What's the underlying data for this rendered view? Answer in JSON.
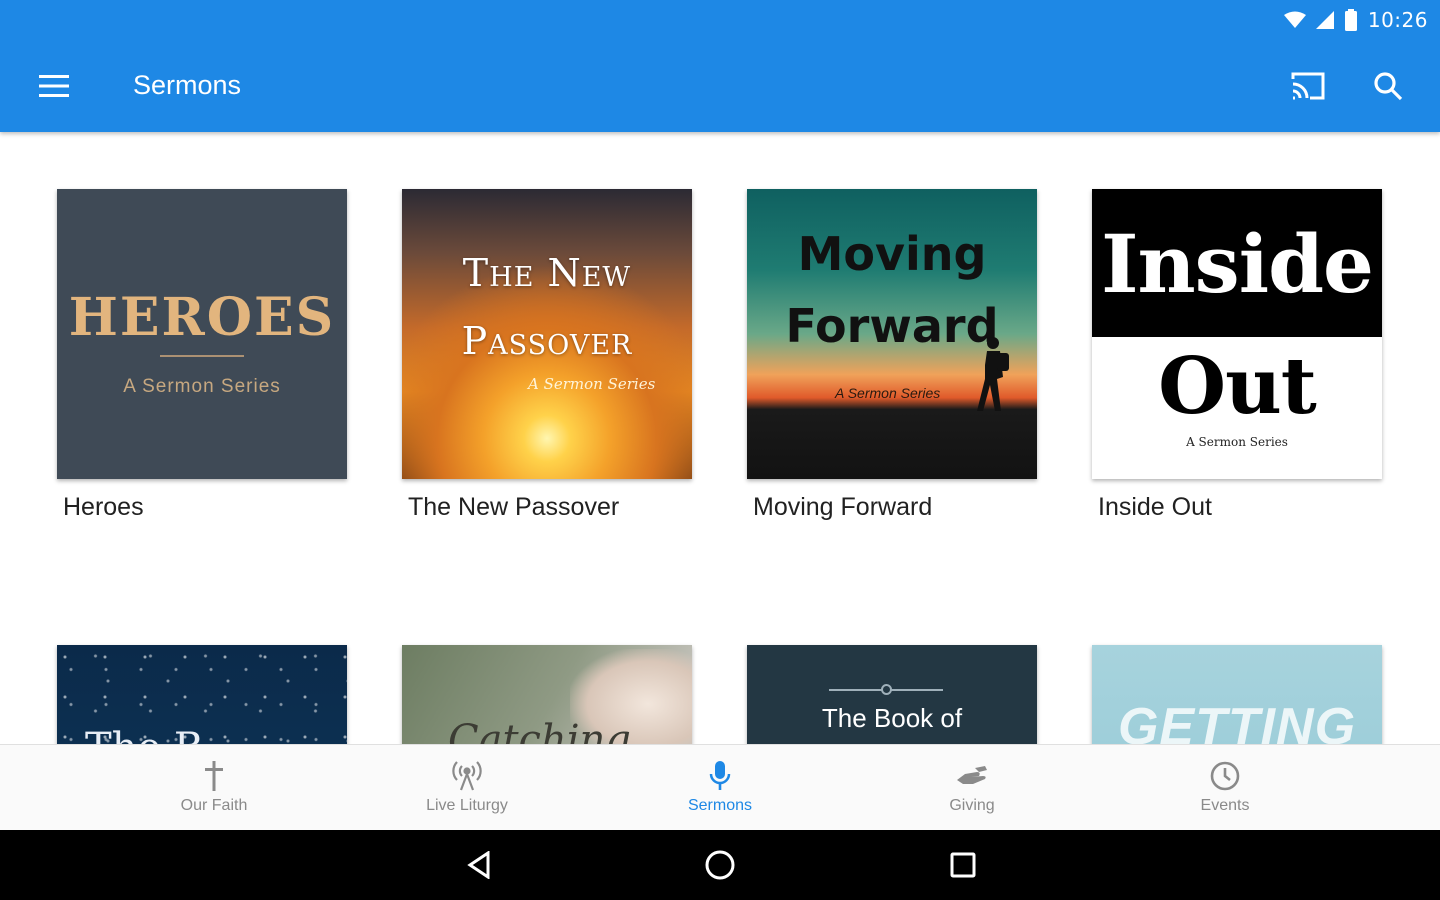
{
  "status_bar": {
    "time": "10:26",
    "icons": [
      "wifi-icon",
      "cellular-icon",
      "battery-icon"
    ]
  },
  "app_bar": {
    "title": "Sermons",
    "actions": [
      "menu-icon",
      "cast-icon",
      "search-icon"
    ],
    "color": "#1e88e5"
  },
  "sermons": [
    {
      "title": "Heroes",
      "art": {
        "line1": "HEROES",
        "subtitle": "A Sermon Series"
      }
    },
    {
      "title": "The New Passover",
      "art": {
        "line1": "The New",
        "line2": "Passover",
        "subtitle": "A Sermon Series"
      }
    },
    {
      "title": "Moving Forward",
      "art": {
        "line1": "Moving",
        "line2": "Forward",
        "subtitle": "A Sermon Series"
      }
    },
    {
      "title": "Inside Out",
      "art": {
        "line1": "Inside",
        "line2": "Out",
        "subtitle": "A Sermon Series"
      }
    },
    {
      "art": {
        "line1": "The B"
      }
    },
    {
      "art": {
        "line1": "Catching"
      }
    },
    {
      "art": {
        "line1": "The Book of"
      }
    },
    {
      "art": {
        "line1": "GETTING"
      }
    }
  ],
  "bottom_nav": [
    {
      "label": "Our Faith",
      "icon": "cross-icon"
    },
    {
      "label": "Live Liturgy",
      "icon": "broadcast-icon"
    },
    {
      "label": "Sermons",
      "icon": "microphone-icon",
      "active": true
    },
    {
      "label": "Giving",
      "icon": "giving-hand-icon"
    },
    {
      "label": "Events",
      "icon": "clock-icon"
    }
  ],
  "accent_color": "#1e88e5",
  "system_nav": [
    "back-icon",
    "home-icon",
    "recents-icon"
  ]
}
